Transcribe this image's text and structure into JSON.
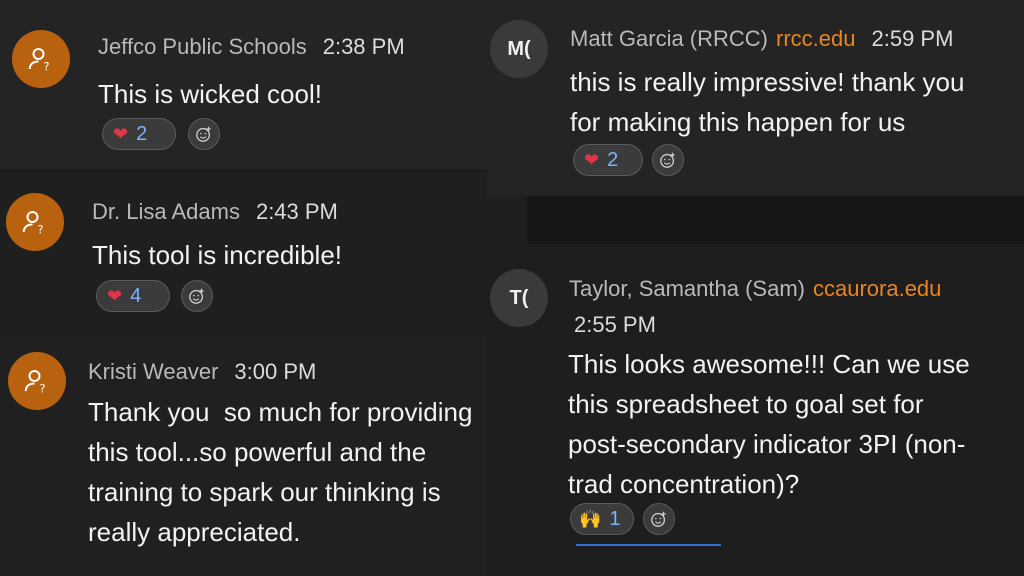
{
  "messages": [
    {
      "author": "Jeffco Public Schools",
      "time": "2:38 PM",
      "text": [
        "This is wicked cool!"
      ],
      "reaction": {
        "emoji": "heart",
        "count": "2"
      }
    },
    {
      "author": "Dr. Lisa Adams",
      "time": "2:43 PM",
      "text": [
        "This tool is incredible!"
      ],
      "reaction": {
        "emoji": "heart",
        "count": "4"
      }
    },
    {
      "author": "Kristi Weaver",
      "time": "3:00 PM",
      "text": [
        "Thank you  so much for providing",
        "this tool...so powerful and the",
        "training to spark our thinking is",
        "really appreciated."
      ]
    },
    {
      "author": "Matt Garcia (RRCC)",
      "initials": "M(",
      "domain": "rrcc.edu",
      "time": "2:59 PM",
      "text": [
        "this is really impressive! thank you",
        "for making this happen for us"
      ],
      "reaction": {
        "emoji": "heart",
        "count": "2"
      }
    },
    {
      "author": "Taylor, Samantha (Sam)",
      "initials": "T(",
      "domain": "ccaurora.edu",
      "time": "2:55 PM",
      "text": [
        "This looks awesome!!! Can we use",
        "this spreadsheet to goal set for",
        "post-secondary indicator 3PI (non-",
        "trad concentration)?"
      ],
      "reaction": {
        "emoji": "raised-hands",
        "count": "1"
      }
    }
  ],
  "colors": {
    "avatar_orange": "#b8620f",
    "domain_orange": "#e8851f",
    "reaction_count_blue": "#7ab4ff",
    "heart_red": "#e0344b"
  }
}
